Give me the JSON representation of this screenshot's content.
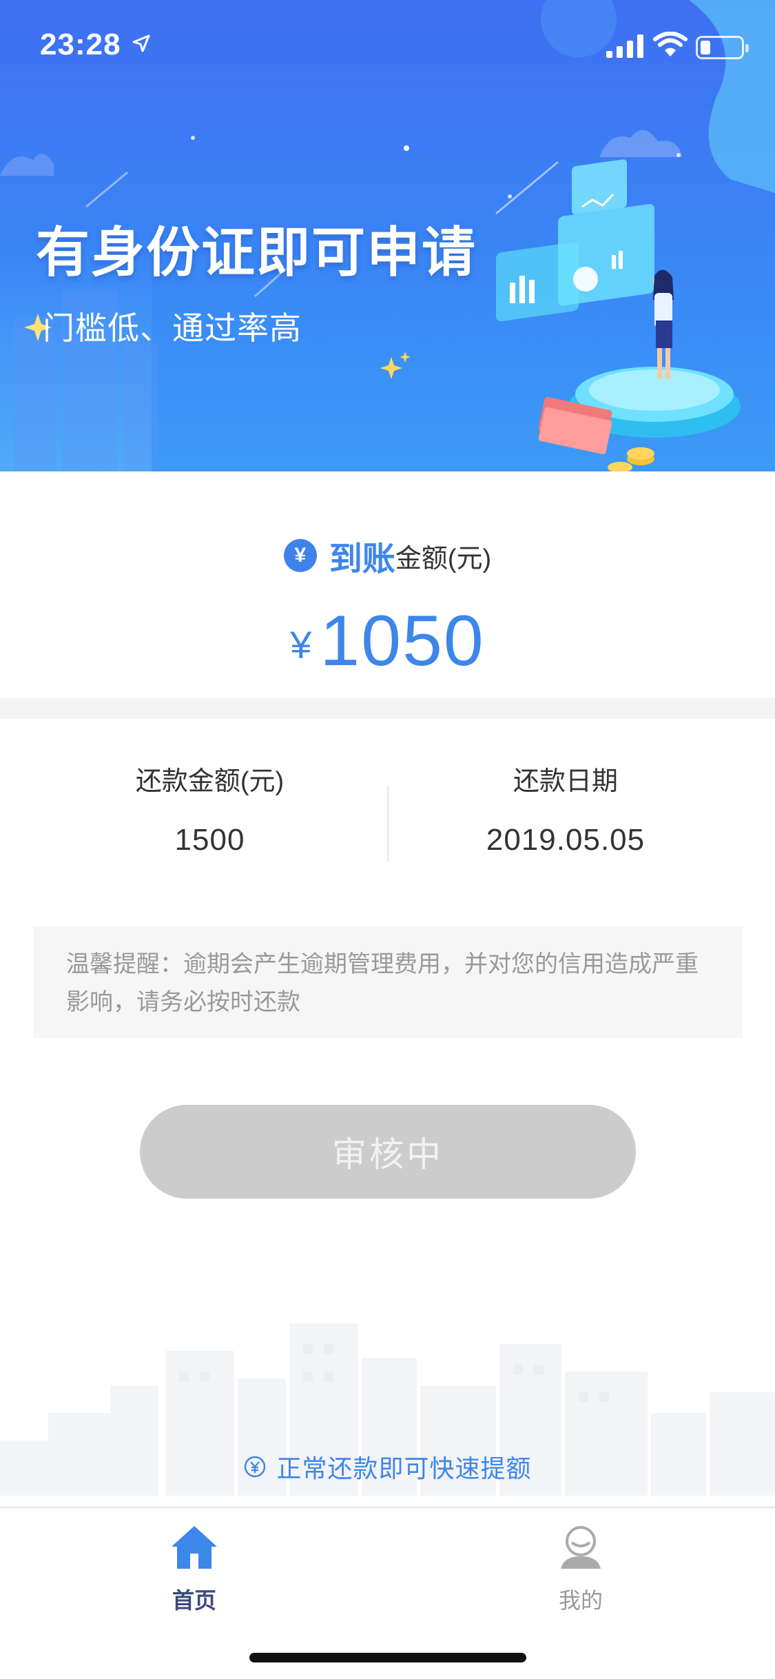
{
  "status_bar": {
    "time": "23:28"
  },
  "banner": {
    "title": "有身份证即可申请",
    "subtitle": "门槛低、通过率高"
  },
  "arrival": {
    "badge": "¥",
    "highlight": "到账",
    "label_rest": "金额(元)",
    "currency": "¥",
    "amount": "1050"
  },
  "repayment": {
    "amount_label": "还款金额(元)",
    "amount_value": "1500",
    "date_label": "还款日期",
    "date_value": "2019.05.05"
  },
  "notice": {
    "text": "温馨提醒：逾期会产生逾期管理费用，并对您的信用造成严重影响，请务必按时还款"
  },
  "status_button": {
    "label": "审核中"
  },
  "tip": {
    "text": "正常还款即可快速提额"
  },
  "tabbar": {
    "items": [
      {
        "label": "首页",
        "icon": "home-icon",
        "active": true
      },
      {
        "label": "我的",
        "icon": "profile-icon",
        "active": false
      }
    ]
  },
  "colors": {
    "accent": "#3d86ea",
    "banner": "#3f6ff2",
    "disabled_button": "#cccccc"
  }
}
